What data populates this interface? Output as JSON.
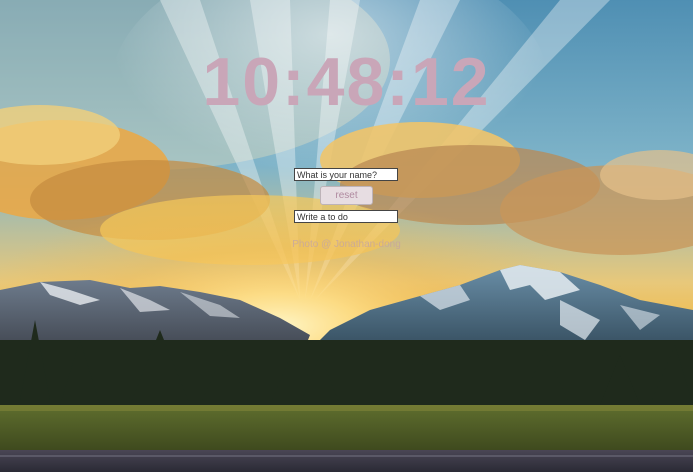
{
  "clock": {
    "time": "10:48:12"
  },
  "greeting_form": {
    "name_placeholder": "What is your name?",
    "reset_label": "reset"
  },
  "todo_form": {
    "placeholder": "Write a to do"
  },
  "background": {
    "credit": "Photo @ Jonathan-dong"
  },
  "colors": {
    "clock": "#c9a6b8",
    "reset_text": "#b08aa0",
    "reset_bg": "#e7dde2"
  }
}
